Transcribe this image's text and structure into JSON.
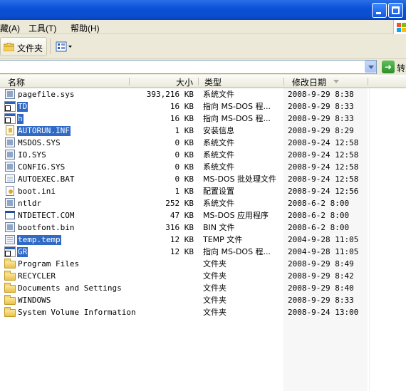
{
  "menu": {
    "edit_partial": "藏(A)",
    "tools": "工具(T)",
    "help": "帮助(H)"
  },
  "toolbar": {
    "folders_label": "文件夹"
  },
  "address": {
    "value": "",
    "go_label": "转到"
  },
  "columns": {
    "name": "名称",
    "size": "大小",
    "type": "类型",
    "modified": "修改日期"
  },
  "files": [
    {
      "name": "pagefile.sys",
      "size": "393,216 KB",
      "type": "系统文件",
      "modified": "2008-9-29 8:38",
      "icon": "system-file-icon",
      "selected": false
    },
    {
      "name": "TD",
      "size": "16 KB",
      "type": "指向 MS-DOS 程...",
      "modified": "2008-9-29 8:33",
      "icon": "shortcut-icon",
      "selected": true
    },
    {
      "name": "h",
      "size": "16 KB",
      "type": "指向 MS-DOS 程...",
      "modified": "2008-9-29 8:33",
      "icon": "shortcut-icon",
      "selected": true
    },
    {
      "name": "AUTORUN.INF",
      "size": "1 KB",
      "type": "安装信息",
      "modified": "2008-9-29 8:29",
      "icon": "setup-info-icon",
      "selected": true
    },
    {
      "name": "MSDOS.SYS",
      "size": "0 KB",
      "type": "系统文件",
      "modified": "2008-9-24 12:58",
      "icon": "system-file-icon",
      "selected": false
    },
    {
      "name": "IO.SYS",
      "size": "0 KB",
      "type": "系统文件",
      "modified": "2008-9-24 12:58",
      "icon": "system-file-icon",
      "selected": false
    },
    {
      "name": "CONFIG.SYS",
      "size": "0 KB",
      "type": "系统文件",
      "modified": "2008-9-24 12:58",
      "icon": "system-file-icon",
      "selected": false
    },
    {
      "name": "AUTOEXEC.BAT",
      "size": "0 KB",
      "type": "MS-DOS 批处理文件",
      "modified": "2008-9-24 12:58",
      "icon": "batch-file-icon",
      "selected": false
    },
    {
      "name": "boot.ini",
      "size": "1 KB",
      "type": "配置设置",
      "modified": "2008-9-24 12:56",
      "icon": "config-file-icon",
      "selected": false
    },
    {
      "name": "ntldr",
      "size": "252 KB",
      "type": "系统文件",
      "modified": "2008-6-2 8:00",
      "icon": "system-file-icon",
      "selected": false
    },
    {
      "name": "NTDETECT.COM",
      "size": "47 KB",
      "type": "MS-DOS 应用程序",
      "modified": "2008-6-2 8:00",
      "icon": "application-icon",
      "selected": false
    },
    {
      "name": "bootfont.bin",
      "size": "316 KB",
      "type": "BIN 文件",
      "modified": "2008-6-2 8:00",
      "icon": "system-file-icon",
      "selected": false
    },
    {
      "name": "temp.temp",
      "size": "12 KB",
      "type": "TEMP 文件",
      "modified": "2004-9-28 11:05",
      "icon": "temp-file-icon",
      "selected": true
    },
    {
      "name": "GR",
      "size": "12 KB",
      "type": "指向 MS-DOS 程...",
      "modified": "2004-9-28 11:05",
      "icon": "shortcut-icon",
      "selected": true
    },
    {
      "name": "Program Files",
      "size": "",
      "type": "文件夹",
      "modified": "2008-9-29 8:49",
      "icon": "folder-icon",
      "selected": false
    },
    {
      "name": "RECYCLER",
      "size": "",
      "type": "文件夹",
      "modified": "2008-9-29 8:42",
      "icon": "folder-icon",
      "selected": false
    },
    {
      "name": "Documents and Settings",
      "size": "",
      "type": "文件夹",
      "modified": "2008-9-29 8:40",
      "icon": "folder-icon",
      "selected": false
    },
    {
      "name": "WINDOWS",
      "size": "",
      "type": "文件夹",
      "modified": "2008-9-29 8:33",
      "icon": "folder-icon",
      "selected": false
    },
    {
      "name": "System Volume Information",
      "size": "",
      "type": "文件夹",
      "modified": "2008-9-24 13:00",
      "icon": "folder-icon",
      "selected": false
    }
  ],
  "colors": {
    "title_bar": "#0a52d8",
    "selection": "#316ac5",
    "chrome": "#ece9d8"
  }
}
